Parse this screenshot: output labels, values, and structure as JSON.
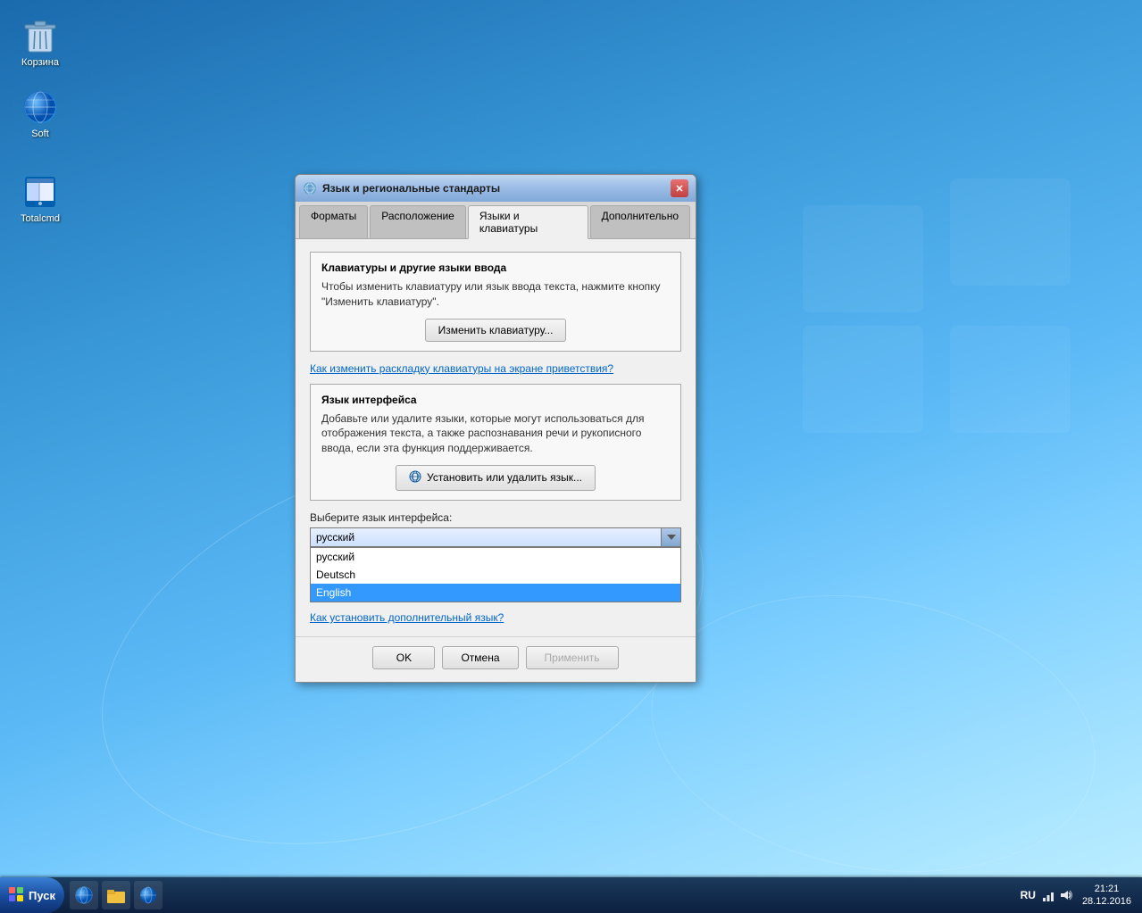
{
  "desktop": {
    "icons": [
      {
        "id": "recycle-bin",
        "label": "Корзина",
        "type": "recycle"
      },
      {
        "id": "soft",
        "label": "Soft",
        "type": "ie"
      },
      {
        "id": "totalcmd",
        "label": "Totalcmd",
        "type": "totalcmd"
      }
    ]
  },
  "dialog": {
    "title": "Язык и региональные стандарты",
    "tabs": [
      {
        "id": "formats",
        "label": "Форматы",
        "active": false
      },
      {
        "id": "location",
        "label": "Расположение",
        "active": false
      },
      {
        "id": "languages",
        "label": "Языки и клавиатуры",
        "active": true
      },
      {
        "id": "advanced",
        "label": "Дополнительно",
        "active": false
      }
    ],
    "keyboard_section": {
      "title": "Клавиатуры и другие языки ввода",
      "description": "Чтобы изменить клавиатуру или язык ввода текста, нажмите кнопку \"Изменить клавиатуру\".",
      "button": "Изменить клавиатуру...",
      "link": "Как изменить раскладку клавиатуры на экране приветствия?"
    },
    "interface_section": {
      "title": "Язык интерфейса",
      "description": "Добавьте или удалите языки, которые могут использоваться для отображения текста, а также распознавания речи и рукописного ввода, если эта функция поддерживается.",
      "button": "Установить или удалить язык...",
      "select_label": "Выберите язык интерфейса:",
      "selected_value": "русский",
      "options": [
        {
          "value": "russian",
          "label": "русский",
          "selected": false
        },
        {
          "value": "deutsch",
          "label": "Deutsch",
          "selected": false
        },
        {
          "value": "english",
          "label": "English",
          "selected": true
        }
      ],
      "link": "Как установить дополнительный язык?"
    },
    "footer": {
      "ok": "OK",
      "cancel": "Отмена",
      "apply": "Применить"
    }
  },
  "taskbar": {
    "start_label": "Пуск",
    "lang": "RU",
    "time": "21:21",
    "date": "28.12.2016"
  }
}
